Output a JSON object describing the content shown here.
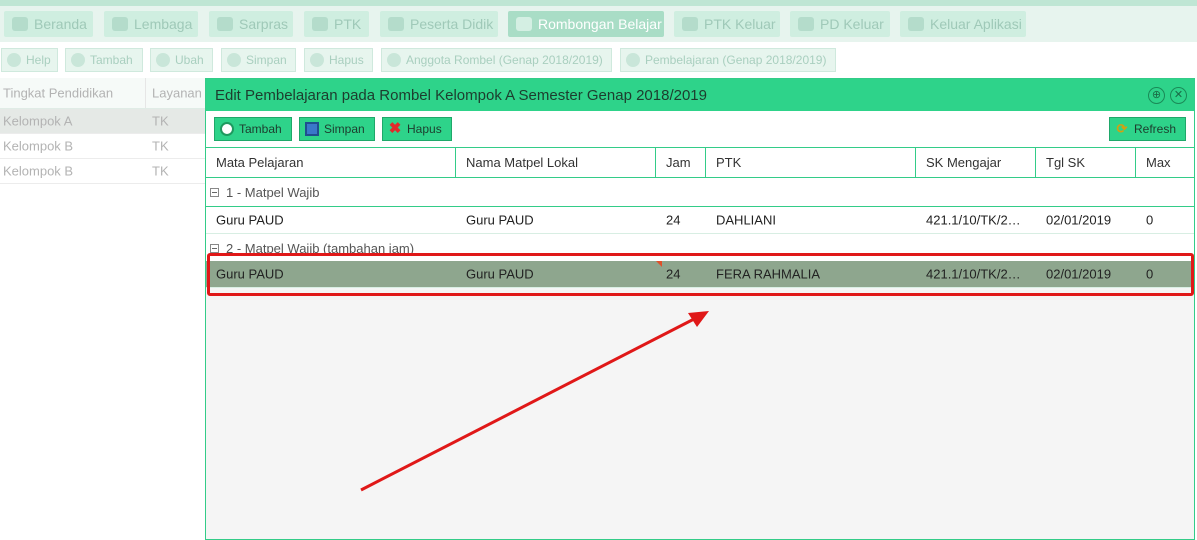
{
  "nav": {
    "tabs": [
      {
        "label": "Beranda",
        "icon": "home-icon"
      },
      {
        "label": "Lembaga",
        "icon": "institution-icon"
      },
      {
        "label": "Sarpras",
        "icon": "facility-icon"
      },
      {
        "label": "PTK",
        "icon": "teacher-icon"
      },
      {
        "label": "Peserta Didik",
        "icon": "students-icon"
      },
      {
        "label": "Rombongan Belajar",
        "icon": "class-group-icon"
      },
      {
        "label": "PTK Keluar",
        "icon": "teacher-exit-icon"
      },
      {
        "label": "PD Keluar",
        "icon": "student-exit-icon"
      },
      {
        "label": "Keluar Aplikasi",
        "icon": "logout-icon"
      }
    ],
    "active": "Rombongan Belajar"
  },
  "toolbar": {
    "buttons": [
      {
        "label": "Help"
      },
      {
        "label": "Tambah"
      },
      {
        "label": "Ubah"
      },
      {
        "label": "Simpan"
      },
      {
        "label": "Hapus"
      },
      {
        "label": "Anggota Rombel (Genap 2018/2019)"
      },
      {
        "label": "Pembelajaran (Genap 2018/2019)"
      }
    ]
  },
  "left_grid": {
    "headers": [
      "Tingkat Pendidikan",
      "Layanan"
    ],
    "rows": [
      [
        "Kelompok A",
        "TK"
      ],
      [
        "Kelompok B",
        "TK"
      ],
      [
        "Kelompok B",
        "TK"
      ]
    ]
  },
  "dialog": {
    "title": "Edit Pembelajaran pada Rombel Kelompok A Semester Genap 2018/2019",
    "buttons": {
      "add": "Tambah",
      "save": "Simpan",
      "delete": "Hapus",
      "refresh": "Refresh"
    },
    "columns": [
      "Mata Pelajaran",
      "Nama Matpel Lokal",
      "Jam",
      "PTK",
      "SK Mengajar",
      "Tgl SK",
      "Max"
    ],
    "groups": [
      {
        "label": "1 - Matpel Wajib",
        "rows": [
          [
            "Guru PAUD",
            "Guru PAUD",
            "24",
            "DAHLIANI",
            "421.1/10/TK/2…",
            "02/01/2019",
            "0"
          ]
        ]
      },
      {
        "label": "2 - Matpel Wajib (tambahan jam)",
        "rows": [
          [
            "Guru PAUD",
            "Guru PAUD",
            "24",
            "FERA RAHMALIA",
            "421.1/10/TK/2…",
            "02/01/2019",
            "0"
          ]
        ]
      }
    ]
  },
  "colors": {
    "accent": "#2ed38a",
    "selected_row": "#8ea68e",
    "annotation": "#e01818"
  }
}
